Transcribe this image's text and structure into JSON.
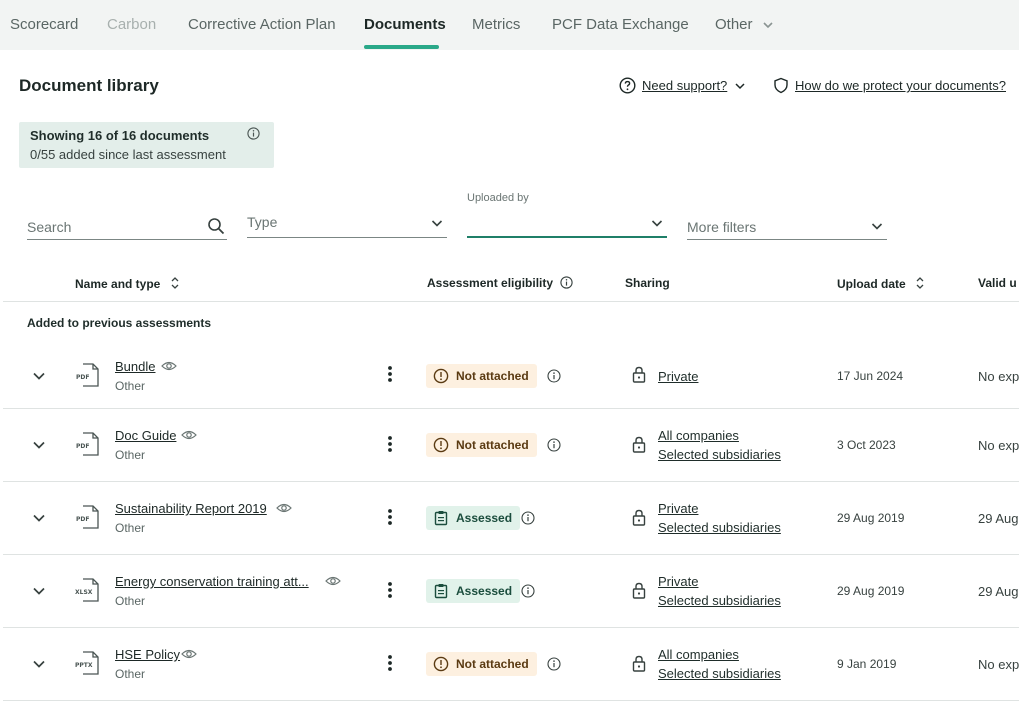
{
  "nav": {
    "tabs": [
      {
        "label": "Scorecard",
        "state": "normal"
      },
      {
        "label": "Carbon",
        "state": "disabled"
      },
      {
        "label": "Corrective Action Plan",
        "state": "normal"
      },
      {
        "label": "Documents",
        "state": "active"
      },
      {
        "label": "Metrics",
        "state": "normal"
      },
      {
        "label": "PCF Data Exchange",
        "state": "normal"
      },
      {
        "label": "Other",
        "state": "normal"
      }
    ]
  },
  "page": {
    "title": "Document library",
    "support_link": "Need support?",
    "protect_link": "How do we protect your documents?"
  },
  "summary": {
    "showing": "Showing 16 of 16 documents",
    "added": "0/55 added since last assessment"
  },
  "filters": {
    "search_placeholder": "Search",
    "type_placeholder": "Type",
    "uploaded_by_label": "Uploaded by",
    "uploaded_by_value": "",
    "more_filters": "More filters"
  },
  "table": {
    "headers": {
      "name": "Name and type",
      "eligibility": "Assessment eligibility",
      "sharing": "Sharing",
      "upload_date": "Upload date",
      "valid": "Valid u"
    },
    "group_label": "Added to previous assessments",
    "rows": [
      {
        "name": "Bundle",
        "file_type": "PDF",
        "category": "Other",
        "eligibility": "Not attached",
        "status": "warn",
        "sharing": [
          "Private"
        ],
        "date": "17 Jun 2024",
        "valid": "No exp"
      },
      {
        "name": "Doc Guide",
        "file_type": "PDF",
        "category": "Other",
        "eligibility": "Not attached",
        "status": "warn",
        "sharing": [
          "All companies",
          "Selected subsidiaries"
        ],
        "date": "3 Oct 2023",
        "valid": "No exp"
      },
      {
        "name": "Sustainability Report 2019",
        "file_type": "PDF",
        "category": "Other",
        "eligibility": "Assessed",
        "status": "ok",
        "sharing": [
          "Private",
          "Selected subsidiaries"
        ],
        "date": "29 Aug 2019",
        "valid": "29 Aug"
      },
      {
        "name": "Energy conservation training att...",
        "file_type": "XLSX",
        "category": "Other",
        "eligibility": "Assessed",
        "status": "ok",
        "sharing": [
          "Private",
          "Selected subsidiaries"
        ],
        "date": "29 Aug 2019",
        "valid": "29 Aug"
      },
      {
        "name": "HSE Policy",
        "file_type": "PPTX",
        "category": "Other",
        "eligibility": "Not attached",
        "status": "warn",
        "sharing": [
          "All companies",
          "Selected subsidiaries"
        ],
        "date": "9 Jan 2019",
        "valid": "No exp"
      }
    ]
  },
  "colors": {
    "accent": "#2aa888",
    "warn_bg": "#fdf0e0",
    "ok_bg": "#e1f2ea"
  }
}
